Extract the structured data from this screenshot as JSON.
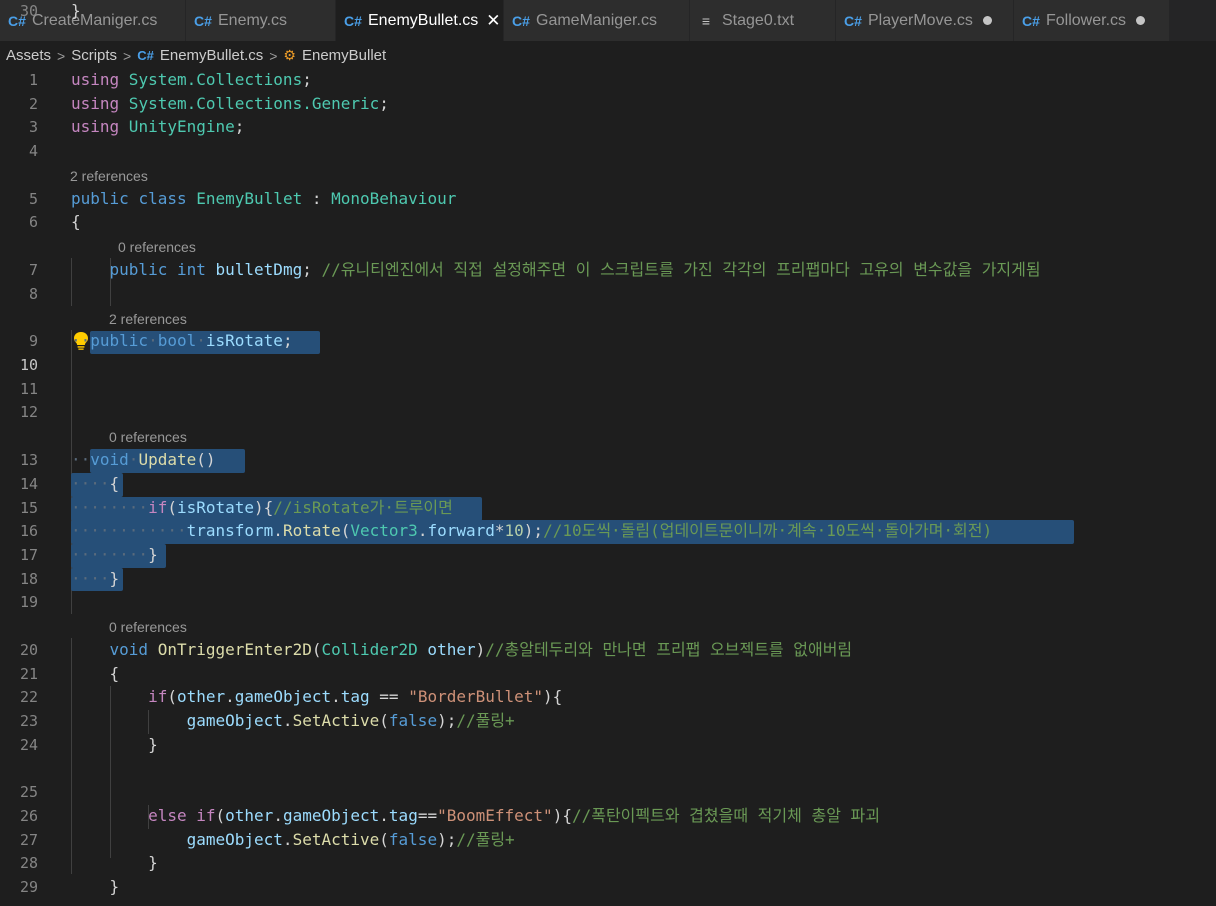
{
  "tabs": [
    {
      "label": "CreateManiger.cs",
      "icon": "csharp-icon",
      "glyph": "C#",
      "active": false,
      "state": "none"
    },
    {
      "label": "Enemy.cs",
      "icon": "csharp-icon",
      "glyph": "C#",
      "active": false,
      "state": "none"
    },
    {
      "label": "EnemyBullet.cs",
      "icon": "csharp-icon",
      "glyph": "C#",
      "active": true,
      "state": "close"
    },
    {
      "label": "GameManiger.cs",
      "icon": "csharp-icon",
      "glyph": "C#",
      "active": false,
      "state": "none"
    },
    {
      "label": "Stage0.txt",
      "icon": "text-file-icon",
      "glyph": "≡",
      "active": false,
      "state": "none"
    },
    {
      "label": "PlayerMove.cs",
      "icon": "csharp-icon",
      "glyph": "C#",
      "active": false,
      "state": "modified"
    },
    {
      "label": "Follower.cs",
      "icon": "csharp-icon",
      "glyph": "C#",
      "active": false,
      "state": "modified"
    }
  ],
  "breadcrumb": {
    "items": [
      "Assets",
      "Scripts",
      "EnemyBullet.cs",
      "EnemyBullet"
    ],
    "separator": ">",
    "file_icon": "csharp-icon",
    "class_icon": "class-icon"
  },
  "editor": {
    "current_line": 10,
    "lens": {
      "l5": "2 references",
      "l7": "0 references",
      "l9": "2 references",
      "l13": "0 references",
      "l20": "0 references"
    },
    "lines": [
      [
        {
          "t": "using",
          "c": "kw2"
        },
        {
          "t": " System.",
          "c": "ty"
        },
        {
          "t": "Collections",
          "c": "ty"
        },
        {
          "t": ";",
          "c": "pl"
        }
      ],
      [
        {
          "t": "using",
          "c": "kw2"
        },
        {
          "t": " System.",
          "c": "ty"
        },
        {
          "t": "Collections.",
          "c": "ty"
        },
        {
          "t": "Generic",
          "c": "ty"
        },
        {
          "t": ";",
          "c": "pl"
        }
      ],
      [
        {
          "t": "using",
          "c": "kw2"
        },
        {
          "t": " UnityEngine",
          "c": "ty"
        },
        {
          "t": ";",
          "c": "pl"
        }
      ],
      [],
      [
        {
          "t": "public",
          "c": "kw"
        },
        {
          "t": " ",
          "c": "pl"
        },
        {
          "t": "class",
          "c": "kw"
        },
        {
          "t": " EnemyBullet ",
          "c": "ty"
        },
        {
          "t": ": ",
          "c": "pl"
        },
        {
          "t": "MonoBehaviour",
          "c": "ty"
        }
      ],
      [
        {
          "t": "{",
          "c": "pl"
        }
      ],
      [
        {
          "t": "    ",
          "c": "pl"
        },
        {
          "t": "public",
          "c": "kw"
        },
        {
          "t": " ",
          "c": "pl"
        },
        {
          "t": "int",
          "c": "kw"
        },
        {
          "t": " bulletDmg",
          "c": "va"
        },
        {
          "t": "; ",
          "c": "pl"
        },
        {
          "t": "//유니티엔진에서 직접 설정해주면 이 스크립트를 가진 각각의 프리팹마다 고유의 변수값을 가지게됨",
          "c": "cm"
        }
      ],
      [],
      [
        {
          "t": "··",
          "c": "dots"
        },
        {
          "t": "public",
          "c": "kw"
        },
        {
          "t": "·",
          "c": "dots"
        },
        {
          "t": "bool",
          "c": "kw"
        },
        {
          "t": "·",
          "c": "dots"
        },
        {
          "t": "isRotate",
          "c": "va"
        },
        {
          "t": ";",
          "c": "pl"
        }
      ],
      [],
      [],
      [],
      [
        {
          "t": "··",
          "c": "dots"
        },
        {
          "t": "void",
          "c": "kw"
        },
        {
          "t": "·",
          "c": "dots"
        },
        {
          "t": "Update",
          "c": "fn"
        },
        {
          "t": "()",
          "c": "pl"
        }
      ],
      [
        {
          "t": "····",
          "c": "dots"
        },
        {
          "t": "{",
          "c": "pl"
        }
      ],
      [
        {
          "t": "········",
          "c": "dots"
        },
        {
          "t": "if",
          "c": "kw2"
        },
        {
          "t": "(",
          "c": "pl"
        },
        {
          "t": "isRotate",
          "c": "va"
        },
        {
          "t": "){",
          "c": "pl"
        },
        {
          "t": "//isRotate가·트루이면",
          "c": "cm"
        }
      ],
      [
        {
          "t": "············",
          "c": "dots"
        },
        {
          "t": "transform",
          "c": "va"
        },
        {
          "t": ".",
          "c": "pl"
        },
        {
          "t": "Rotate",
          "c": "fn"
        },
        {
          "t": "(",
          "c": "pl"
        },
        {
          "t": "Vector3",
          "c": "ty"
        },
        {
          "t": ".",
          "c": "pl"
        },
        {
          "t": "forward",
          "c": "va"
        },
        {
          "t": "*",
          "c": "pl"
        },
        {
          "t": "10",
          "c": "nu"
        },
        {
          "t": ");",
          "c": "pl"
        },
        {
          "t": "//10도씩·돌림(업데이트문이니까·계속·10도씩·돌아가며·회전)",
          "c": "cm"
        }
      ],
      [
        {
          "t": "········",
          "c": "dots"
        },
        {
          "t": "}",
          "c": "pl"
        }
      ],
      [
        {
          "t": "····",
          "c": "dots"
        },
        {
          "t": "}",
          "c": "pl"
        }
      ],
      [],
      [
        {
          "t": "    ",
          "c": "pl"
        },
        {
          "t": "void",
          "c": "kw"
        },
        {
          "t": " ",
          "c": "pl"
        },
        {
          "t": "OnTriggerEnter2D",
          "c": "fn"
        },
        {
          "t": "(",
          "c": "pl"
        },
        {
          "t": "Collider2D",
          "c": "ty"
        },
        {
          "t": " other",
          "c": "va"
        },
        {
          "t": ")",
          "c": "pl"
        },
        {
          "t": "//총알테두리와 만나면 프리팹 오브젝트를 없애버림",
          "c": "cm"
        }
      ],
      [
        {
          "t": "    {",
          "c": "pl"
        }
      ],
      [
        {
          "t": "        ",
          "c": "pl"
        },
        {
          "t": "if",
          "c": "kw2"
        },
        {
          "t": "(",
          "c": "pl"
        },
        {
          "t": "other",
          "c": "va"
        },
        {
          "t": ".",
          "c": "pl"
        },
        {
          "t": "gameObject",
          "c": "va"
        },
        {
          "t": ".",
          "c": "pl"
        },
        {
          "t": "tag",
          "c": "va"
        },
        {
          "t": " == ",
          "c": "pl"
        },
        {
          "t": "\"BorderBullet\"",
          "c": "st"
        },
        {
          "t": "){",
          "c": "pl"
        }
      ],
      [
        {
          "t": "            ",
          "c": "pl"
        },
        {
          "t": "gameObject",
          "c": "va"
        },
        {
          "t": ".",
          "c": "pl"
        },
        {
          "t": "SetActive",
          "c": "fn"
        },
        {
          "t": "(",
          "c": "pl"
        },
        {
          "t": "false",
          "c": "kw"
        },
        {
          "t": ");",
          "c": "pl"
        },
        {
          "t": "//풀링+",
          "c": "cm"
        }
      ],
      [
        {
          "t": "        }",
          "c": "pl"
        }
      ],
      [],
      [
        {
          "t": "        ",
          "c": "pl"
        },
        {
          "t": "else",
          "c": "kw2"
        },
        {
          "t": " ",
          "c": "pl"
        },
        {
          "t": "if",
          "c": "kw2"
        },
        {
          "t": "(",
          "c": "pl"
        },
        {
          "t": "other",
          "c": "va"
        },
        {
          "t": ".",
          "c": "pl"
        },
        {
          "t": "gameObject",
          "c": "va"
        },
        {
          "t": ".",
          "c": "pl"
        },
        {
          "t": "tag",
          "c": "va"
        },
        {
          "t": "==",
          "c": "pl"
        },
        {
          "t": "\"BoomEffect\"",
          "c": "st"
        },
        {
          "t": "){",
          "c": "pl"
        },
        {
          "t": "//폭탄이펙트와 겹쳤을때 적기체 총알 파괴",
          "c": "cm"
        }
      ],
      [
        {
          "t": "            ",
          "c": "pl"
        },
        {
          "t": "gameObject",
          "c": "va"
        },
        {
          "t": ".",
          "c": "pl"
        },
        {
          "t": "SetActive",
          "c": "fn"
        },
        {
          "t": "(",
          "c": "pl"
        },
        {
          "t": "false",
          "c": "kw"
        },
        {
          "t": ");",
          "c": "pl"
        },
        {
          "t": "//풀링+",
          "c": "cm"
        }
      ],
      [
        {
          "t": "        }",
          "c": "pl"
        }
      ],
      [
        {
          "t": "    }",
          "c": "pl"
        }
      ],
      [
        {
          "t": "}",
          "c": "pl"
        }
      ]
    ]
  }
}
